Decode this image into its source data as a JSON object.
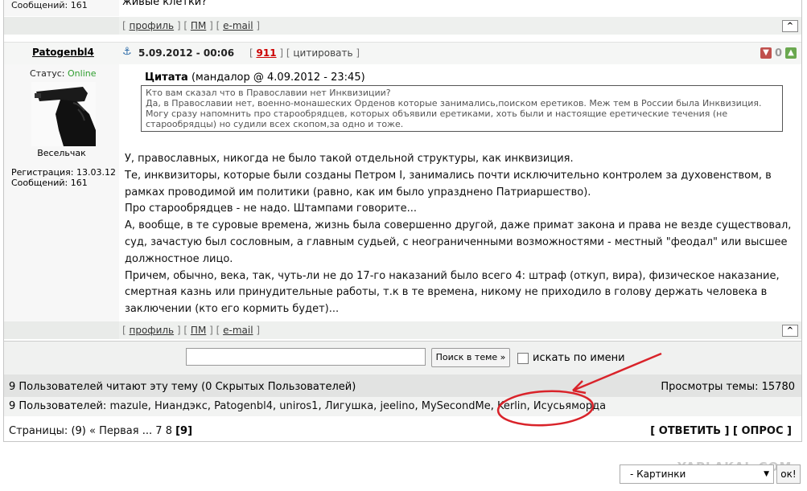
{
  "prev_post": {
    "stats": "Сообщений: 161",
    "text_fragment": "живые клетки?",
    "links": {
      "profile": "профиль",
      "pm": "ПМ",
      "email": "e-mail"
    },
    "up": "^"
  },
  "post": {
    "author": "Patogenbl4",
    "date": "5.09.2012 - 00:06",
    "rating_num": "911",
    "quote_link": "цитировать",
    "score": "0",
    "status_label": "Статус:",
    "status_value": "Online",
    "rank": "Весельчак",
    "registration": "Регистрация: 13.03.12",
    "messages": "Сообщений: 161",
    "quote_title": "Цитата",
    "quote_meta": "(мандалор @ 4.09.2012 - 23:45)",
    "quote_lines": [
      "Кто вам сказал что в Православии нет Инквизиции?",
      "Да, в Православии нет, военно-монашеских Орденов которые занимались,поиском еретиков. Меж тем в России была Инквизиция.",
      "Могу сразу напомнить про старообрядцев, которых объявили еретиками, хоть были и настоящие еретические течения (не старообрядцы) но судили всех скопом,за одно и тоже."
    ],
    "body": [
      "У, православных, никогда не было такой отдельной структуры, как инквизиция.",
      "Те, инквизиторы, которые были созданы Петром I, занимались почти исключительно контролем за духовенством, в рамках проводимой им политики (равно, как им было упразднено Патриаршество).",
      "Про старообрядцев - не надо. Штампами говорите...",
      "А, вообще, в те суровые времена, жизнь была совершенно другой, даже примат закона и права не везде существовал, суд, зачастую был сословным, а главным судьей, с неограниченными возможностями - местный \"феодал\" или высшее должностное лицо.",
      "Причем, обычно, века, так, чуть-ли не до 17-го наказаний было всего 4: штраф (откуп, вира), физическое наказание, смертная казнь или принудительные работы, т.к в те времена, никому не приходило в голову держать человека в заключении (кто его кормить будет)..."
    ],
    "links": {
      "profile": "профиль",
      "pm": "ПМ",
      "email": "e-mail"
    },
    "up": "^"
  },
  "search": {
    "value": "",
    "button": "Поиск в теме »",
    "checkbox_label": "искать по имени"
  },
  "readers": {
    "text": "9 Пользователей читают эту тему (0 Скрытых Пользователей)",
    "views": "Просмотры темы: 15780"
  },
  "users": {
    "prefix": "9 Пользователей:",
    "names": [
      "mazule",
      "Ниандэкс",
      "Patogenbl4",
      "uniros1",
      "Лигушка",
      "jeelino",
      "MySecondMe",
      "Kerlin",
      "Исусьямордa"
    ]
  },
  "pagination": {
    "label": "Страницы:",
    "count": "(9)",
    "first": "« Первая",
    "ellipsis": "...",
    "p7": "7",
    "p8": "8",
    "current": "[9]"
  },
  "actions": {
    "reply": "ОТВЕТИТЬ",
    "poll": "ОПРОС"
  },
  "bottom": {
    "select_value": "- Картинки",
    "ok": "ок!",
    "watermark": "YAPLAKAL.COM"
  },
  "colors": {
    "online": "#2f9e2f",
    "rating": "#cc0000",
    "annotation": "#d9232a"
  }
}
